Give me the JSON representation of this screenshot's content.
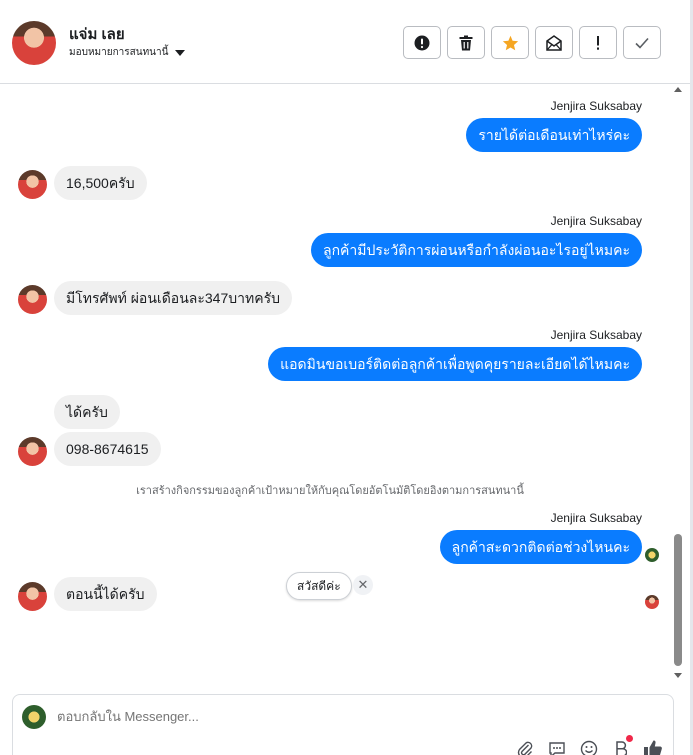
{
  "header": {
    "contact_name": "แจ่ม เลย",
    "assign_label": "มอบหมายการสนทนานี้",
    "actions": [
      "report",
      "delete",
      "star",
      "mark-unread",
      "spam",
      "done"
    ]
  },
  "messages": [
    {
      "dir": "out",
      "sender": "Jenjira Suksabay",
      "text": "รายได้ต่อเดือนเท่าไหร่คะ"
    },
    {
      "dir": "in",
      "text": "16,500ครับ"
    },
    {
      "dir": "out",
      "sender": "Jenjira Suksabay",
      "text": "ลูกค้ามีประวัติการผ่อนหรือกำลังผ่อนอะไรอยู่ไหมคะ"
    },
    {
      "dir": "in",
      "text": "มีโทรศัพท์ ผ่อนเดือนละ347บาทครับ"
    },
    {
      "dir": "out",
      "sender": "Jenjira Suksabay",
      "text": "แอดมินขอเบอร์ติดต่อลูกค้าเพื่อพูดคุยรายละเอียดได้ไหมคะ"
    },
    {
      "dir": "in",
      "text": "ได้ครับ"
    },
    {
      "dir": "in",
      "text": "098-8674615"
    },
    {
      "dir": "out",
      "sender": "Jenjira Suksabay",
      "text": "ลูกค้าสะดวกติดต่อช่วงไหนคะ"
    },
    {
      "dir": "in",
      "text": "ตอนนี้ได้ครับ"
    }
  ],
  "system_note": "เราสร้างกิจกรรมของลูกค้าเป้าหมายให้กับคุณโดยอัตโนมัติโดยอิงตามการสนทนานี้",
  "suggestion": {
    "label": "สวัสดีค่ะ",
    "close": "✕"
  },
  "composer": {
    "placeholder": "ตอบกลับใน Messenger...",
    "tools": [
      "attach-icon",
      "saved-reply-icon",
      "emoji-icon",
      "bold-icon",
      "like-icon"
    ]
  },
  "colors": {
    "outgoing_bubble": "#0a7cff",
    "incoming_bubble": "#f0f0f0",
    "star": "#f5a623",
    "badge": "#f02849"
  }
}
